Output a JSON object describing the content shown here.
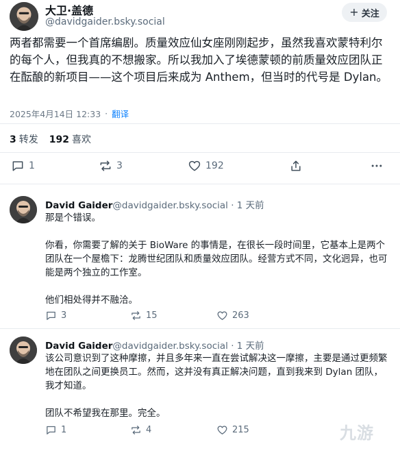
{
  "post": {
    "author_name": "大卫·盖德",
    "author_handle": "@davidgaider.bsky.social",
    "follow_label": "关注",
    "text": "两者都需要一个首席编剧。质量效应仙女座刚刚起步，虽然我喜欢蒙特利尔的每个人，但我真的不想搬家。所以我加入了埃德蒙顿的前质量效应团队正在酝酿的新项目——这个项目后来成为 Anthem，但当时的代号是 Dylan。",
    "timestamp": "2025年4月14日 12:33",
    "separator": "·",
    "translate_label": "翻译",
    "reposts_count": "3",
    "reposts_label": "转发",
    "likes_count": "192",
    "likes_label": "喜欢",
    "actions": {
      "replies": "1",
      "reposts": "3",
      "likes": "192"
    }
  },
  "replies": [
    {
      "author_name": "David Gaider",
      "author_handle": "@davidgaider.bsky.social",
      "time": "· 1 天前",
      "paragraphs": [
        "那是个错误。",
        "你看，你需要了解的关于 BioWare 的事情是，在很长一段时间里，它基本上是两个团队在一个屋檐下：龙腾世纪团队和质量效应团队。经营方式不同，文化迥异，也可能是两个独立的工作室。",
        "他们相处得并不融洽。"
      ],
      "actions": {
        "replies": "3",
        "reposts": "15",
        "likes": "263"
      }
    },
    {
      "author_name": "David Gaider",
      "author_handle": "@davidgaider.bsky.social",
      "time": "· 1 天前",
      "paragraphs": [
        "该公司意识到了这种摩擦，并且多年来一直在尝试解决这一摩擦，主要是通过更频繁地在团队之间更换员工。然而，这并没有真正解决问题，直到我来到 Dylan 团队，我才知道。",
        "团队不希望我在那里。完全。"
      ],
      "actions": {
        "replies": "1",
        "reposts": "4",
        "likes": "215"
      }
    }
  ],
  "watermark": "九游",
  "icons": [
    "reply-icon",
    "repost-icon",
    "like-icon",
    "share-icon",
    "more-icon"
  ],
  "colors": {
    "link": "#1083fe",
    "muted": "#5b6b7b",
    "follow_bg": "#eef1f4"
  }
}
